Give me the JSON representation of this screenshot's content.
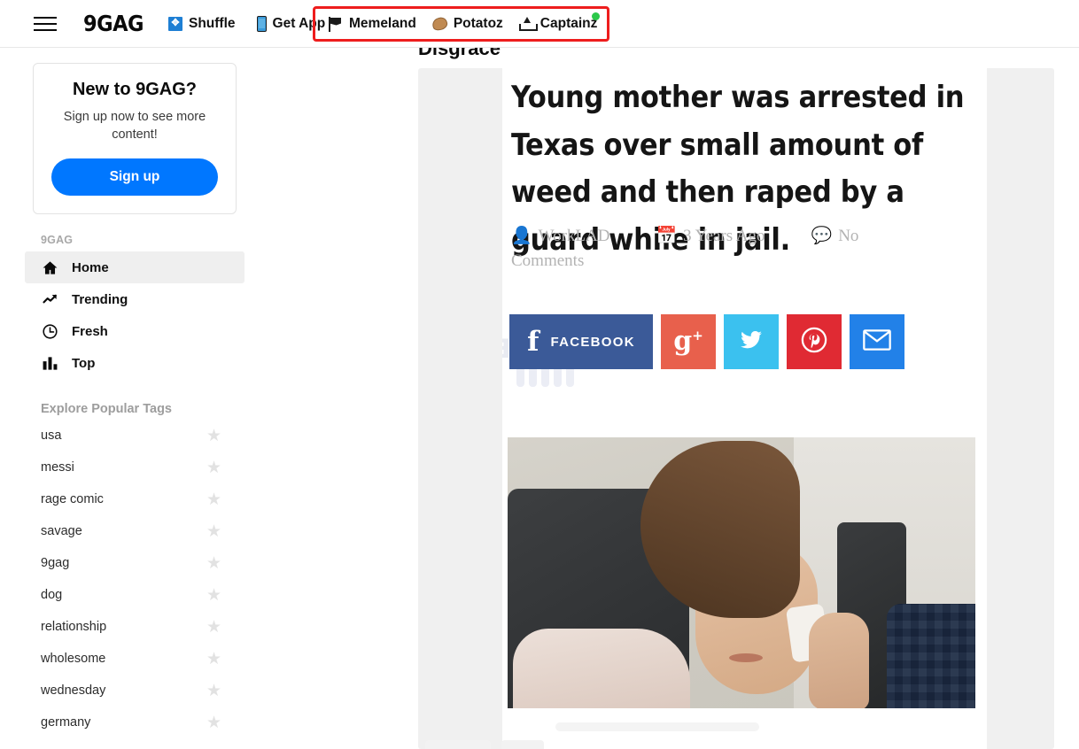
{
  "topnav": {
    "menu_icon": "hamburger-icon",
    "brand": "9GAG",
    "items": [
      {
        "label": "Shuffle",
        "icon": "shuffle-icon"
      },
      {
        "label": "Get App",
        "icon": "phone-icon"
      }
    ],
    "highlighted_items": [
      {
        "label": "Memeland",
        "icon": "pirate-flag-icon",
        "badge": ""
      },
      {
        "label": "Potatoz",
        "icon": "potato-icon",
        "badge": ""
      },
      {
        "label": "Captainz",
        "icon": "captain-upload-icon",
        "badge": "online-dot"
      }
    ],
    "highlight_color": "#ee1d1d"
  },
  "sidebar": {
    "signup_card": {
      "title": "New to 9GAG?",
      "subtitle": "Sign up now to see more content!",
      "button_label": "Sign up",
      "button_color": "#0077ff"
    },
    "section_label": "9GAG",
    "nav_items": [
      {
        "label": "Home",
        "icon": "home-icon",
        "active": true
      },
      {
        "label": "Trending",
        "icon": "trending-arrow-icon",
        "active": false
      },
      {
        "label": "Fresh",
        "icon": "clock-icon",
        "active": false
      },
      {
        "label": "Top",
        "icon": "bar-chart-icon",
        "active": false
      }
    ],
    "tags_label": "Explore Popular Tags",
    "tags": [
      {
        "name": "usa",
        "star": "★"
      },
      {
        "name": "messi",
        "star": "★"
      },
      {
        "name": "rage comic",
        "star": "★"
      },
      {
        "name": "savage",
        "star": "★"
      },
      {
        "name": "9gag",
        "star": "★"
      },
      {
        "name": "dog",
        "star": "★"
      },
      {
        "name": "relationship",
        "star": "★"
      },
      {
        "name": "wholesome",
        "star": "★"
      },
      {
        "name": "wednesday",
        "star": "★"
      },
      {
        "name": "germany",
        "star": "★"
      }
    ]
  },
  "post": {
    "title": "Disgrace",
    "meme": {
      "headline": "Young mother was arrested in Texas over small amount of weed and then raped by a guard while in jail.",
      "author_icon": "user-icon",
      "author": "WorkLAD",
      "date_icon": "calendar-icon",
      "date": "3 Years Ago",
      "comments_icon": "comment-icon",
      "comments": "No Comments",
      "watermark": "BLOCKBEATS",
      "share_buttons": [
        {
          "label": "FACEBOOK",
          "glyph": "f",
          "color": "#3b5a98",
          "icon": "facebook-icon"
        },
        {
          "label": "",
          "glyph": "g+",
          "color": "#e8604c",
          "icon": "google-plus-icon"
        },
        {
          "label": "",
          "glyph": "🐦",
          "color": "#3bc1ef",
          "icon": "twitter-icon"
        },
        {
          "label": "",
          "glyph": "Ⓟ",
          "color": "#e02a33",
          "icon": "pinterest-icon"
        },
        {
          "label": "",
          "glyph": "✉",
          "color": "#2281e8",
          "icon": "email-icon"
        }
      ],
      "photo_alt": "crying-woman-photo"
    }
  }
}
